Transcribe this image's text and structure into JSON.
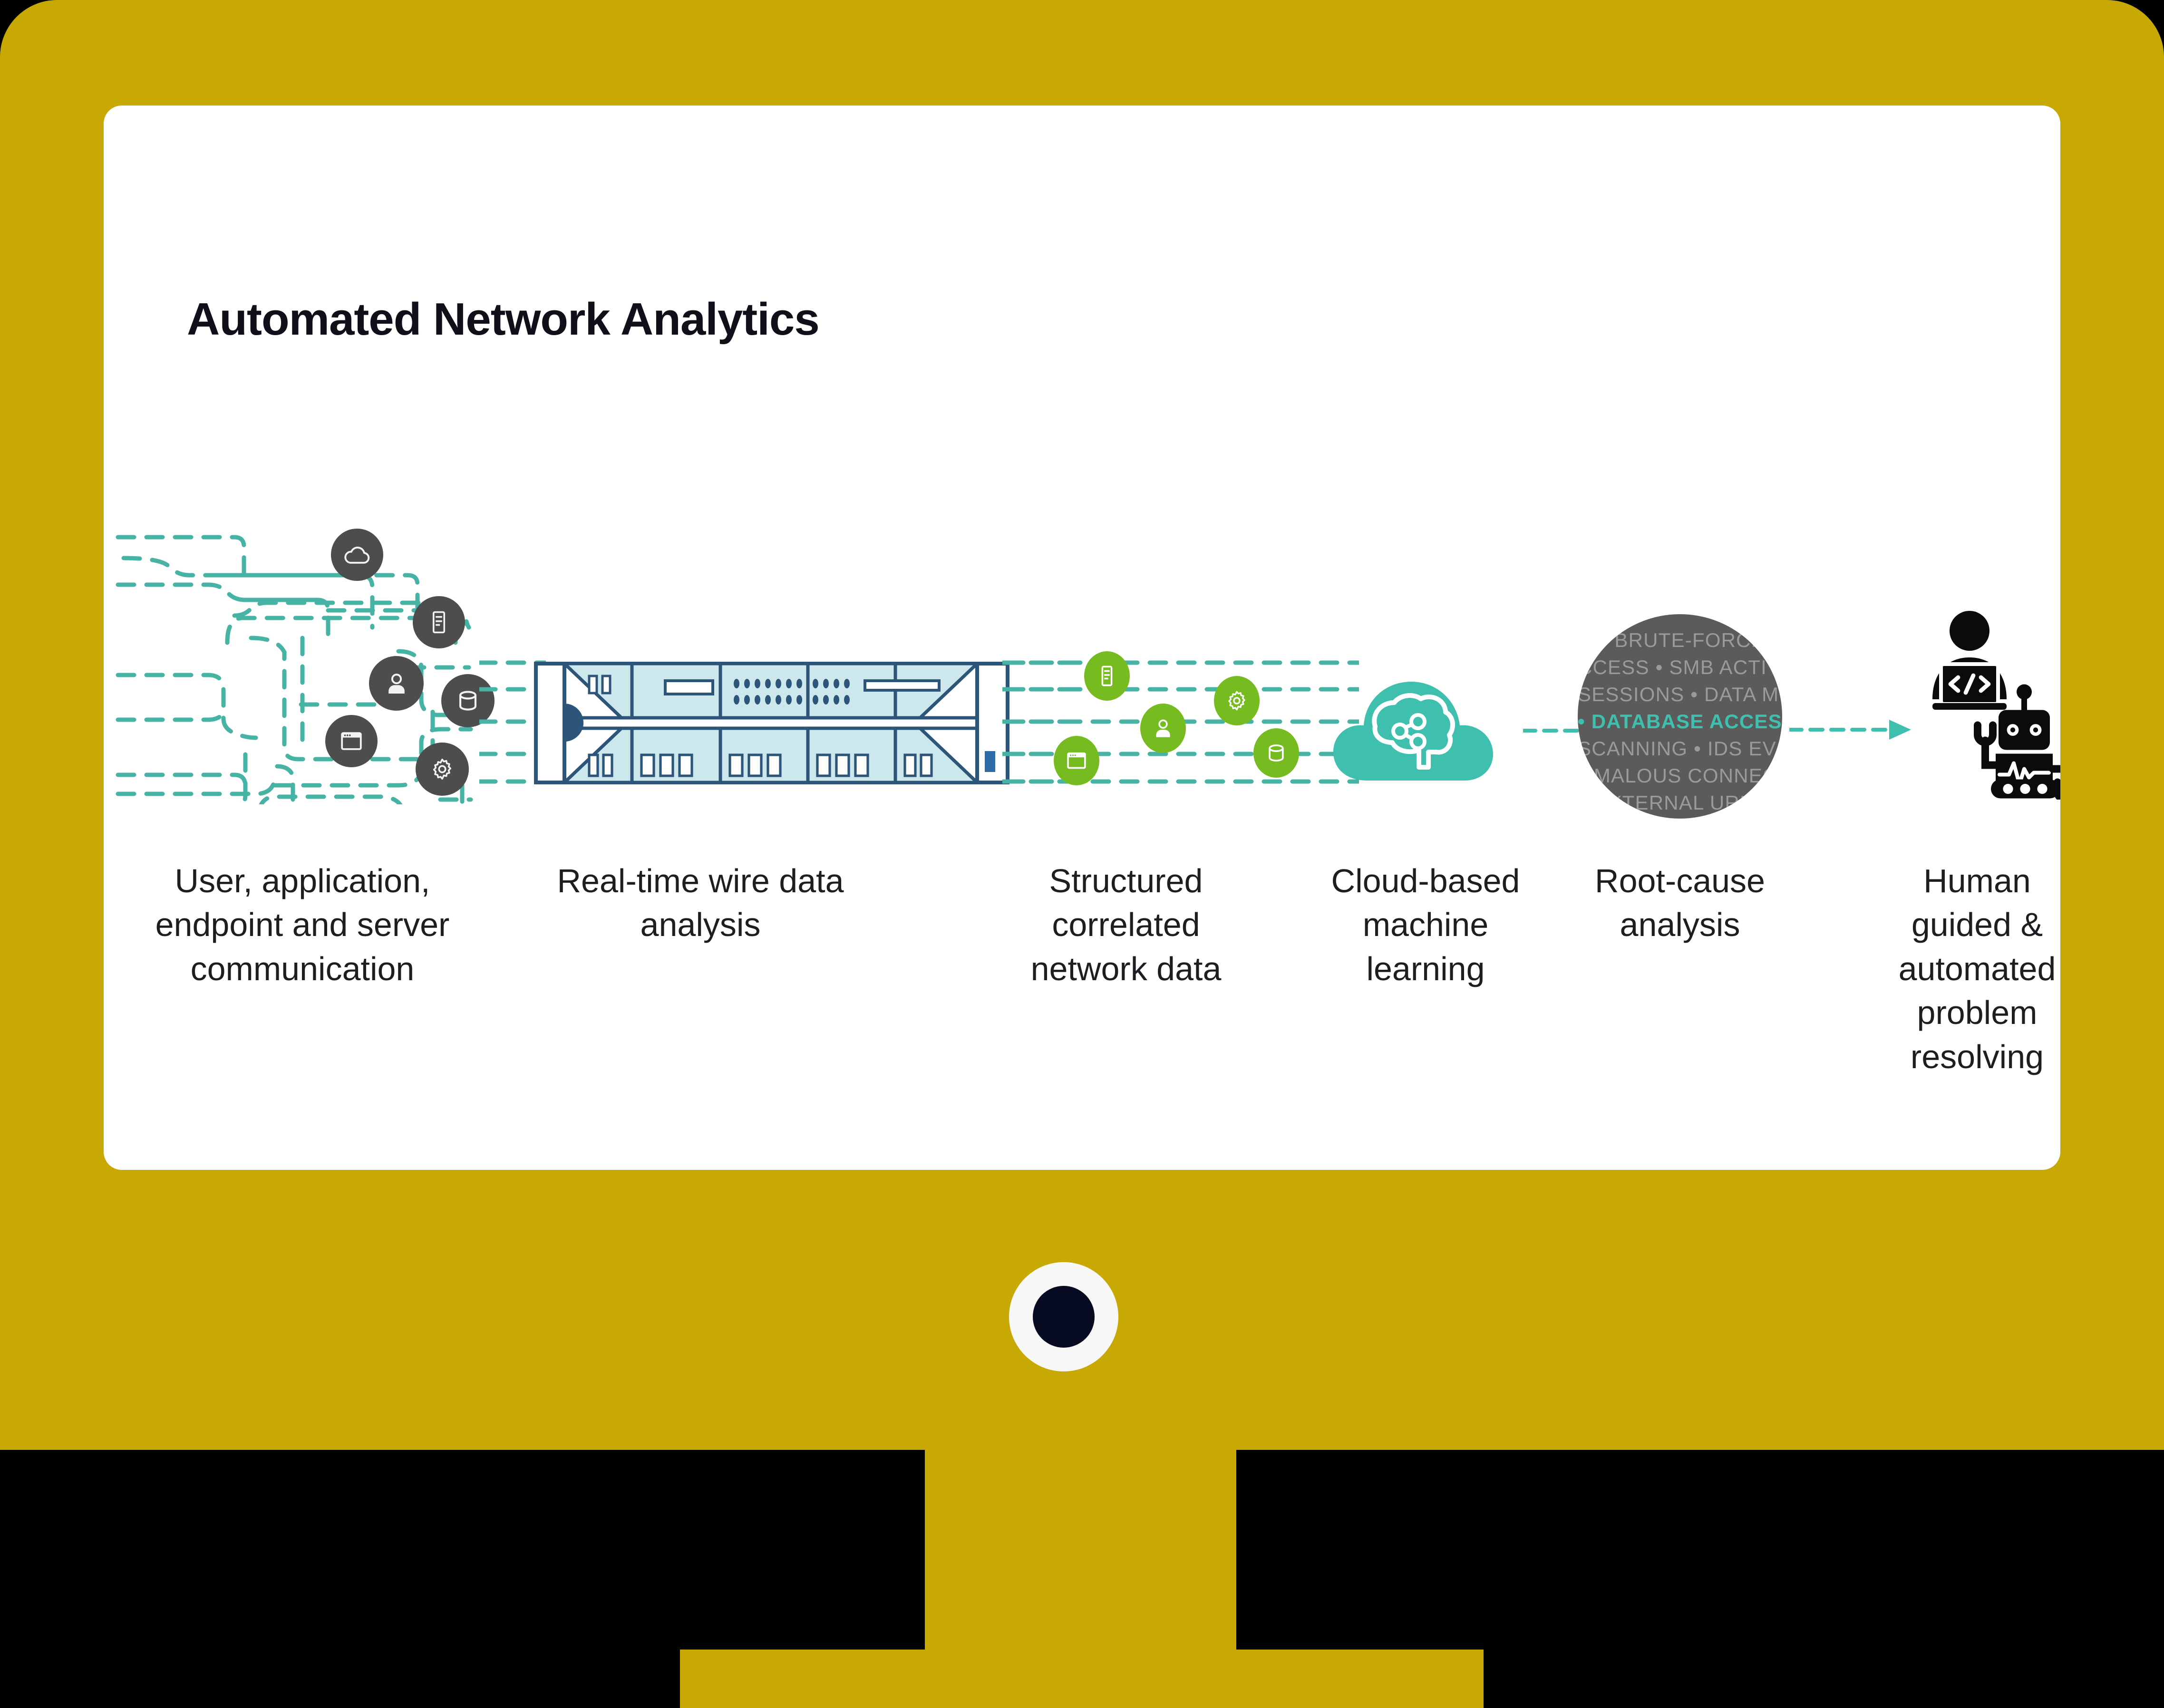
{
  "device": {
    "type": "desktop-monitor",
    "bezel_color": "#c8a802",
    "screen_background": "#ffffff",
    "frame_background": "#000000"
  },
  "slide": {
    "title": "Automated Network Analytics"
  },
  "colors": {
    "teal": "#3fbfae",
    "teal_dash": "#46b3a5",
    "green": "#76bc21",
    "dark_gray": "#4d4d4d",
    "circle_gray": "#5b5b5b",
    "circle_text": "#9a9a9a",
    "appliance_fill": "#cde8ed",
    "appliance_stroke": "#2d5579",
    "label_text": "#1d1d22"
  },
  "stages": [
    {
      "id": "stage-1",
      "label": "User, application, endpoint and server communication",
      "lines": [
        "User, application,",
        "endpoint and server",
        "communication"
      ],
      "icons": [
        "cloud-icon",
        "server-icon",
        "user-icon",
        "database-icon",
        "browser-window-icon",
        "gear-icon"
      ]
    },
    {
      "id": "stage-2",
      "label": "Real-time wire data analysis",
      "lines": [
        "Real-time wire data",
        "analysis"
      ],
      "icons": [
        "network-appliance-icon"
      ]
    },
    {
      "id": "stage-3",
      "label": "Structured correlated network data",
      "lines": [
        "Structured",
        "correlated",
        "network data"
      ],
      "icons": [
        "server-icon",
        "gear-icon",
        "user-icon",
        "browser-window-icon",
        "database-icon"
      ]
    },
    {
      "id": "stage-4",
      "label": "Cloud-based machine learning",
      "lines": [
        "Cloud-based",
        "machine",
        "learning"
      ],
      "icons": [
        "cloud-brain-icon"
      ]
    },
    {
      "id": "stage-5",
      "label": "Root-cause analysis",
      "lines": [
        "Root-cause",
        "analysis"
      ],
      "icons": [
        "root-cause-circle"
      ]
    },
    {
      "id": "stage-6",
      "label": "Human guided & automated problem resolving",
      "lines": [
        "Human",
        "guided &",
        "automated",
        "problem",
        "resolving"
      ],
      "icons": [
        "person-at-laptop-icon",
        "robot-icon"
      ]
    }
  ],
  "root_cause_circle": {
    "lines": [
      {
        "text": "P BRUTE-FORCE",
        "highlight": false
      },
      {
        "text": "CCESS • SMB ACTIVITY •",
        "highlight": false
      },
      {
        "text": "SESSIONS • DATA MOVEMEN",
        "highlight": false
      },
      {
        "text": "• DATABASE ACCESS •",
        "highlight": true
      },
      {
        "text": "SCANNING • IDS EVASION",
        "highlight": false
      },
      {
        "text": "OMALOUS CONNECTION",
        "highlight": false
      },
      {
        "text": "EXTERNAL URLS",
        "highlight": false
      }
    ]
  },
  "connectors": [
    {
      "id": "arrow-cloud-to-rootcause",
      "style": "dashed-open-chevron",
      "color": "#3fbfae"
    },
    {
      "id": "arrow-rootcause-to-human",
      "style": "dashed-solid-triangle",
      "color": "#3fbfae"
    }
  ]
}
